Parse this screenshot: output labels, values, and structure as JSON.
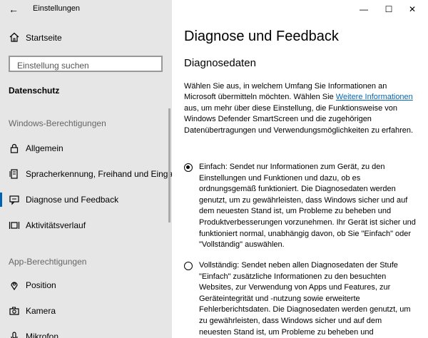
{
  "window": {
    "app_title": "Einstellungen",
    "back_icon": "←",
    "minimize_icon": "—",
    "maximize_icon": "☐",
    "close_icon": "✕"
  },
  "sidebar": {
    "home_label": "Startseite",
    "search_placeholder": "Einstellung suchen",
    "current_section": "Datenschutz",
    "group1_title": "Windows-Berechtigungen",
    "items": [
      {
        "label": "Allgemein",
        "icon": "lock-icon"
      },
      {
        "label": "Spracherkennung, Freihand und Eingabe",
        "icon": "inking-icon"
      },
      {
        "label": "Diagnose und Feedback",
        "icon": "feedback-icon",
        "active": true
      },
      {
        "label": "Aktivitätsverlauf",
        "icon": "timeline-icon"
      }
    ],
    "group2_title": "App-Berechtigungen",
    "app_items": [
      {
        "label": "Position",
        "icon": "location-icon"
      },
      {
        "label": "Kamera",
        "icon": "camera-icon"
      },
      {
        "label": "Mikrofon",
        "icon": "microphone-icon"
      }
    ]
  },
  "main": {
    "title": "Diagnose und Feedback",
    "subtitle": "Diagnosedaten",
    "intro_before": "Wählen Sie aus, in welchem Umfang Sie Informationen an Microsoft übermitteln möchten. Wählen Sie ",
    "intro_link": "Weitere Informationen",
    "intro_after": " aus, um mehr über diese Einstellung, die Funktionsweise von Windows Defender SmartScreen und die zugehörigen Datenübertragungen und Verwendungsmöglichkeiten zu erfahren.",
    "option_basic": "Einfach: Sendet nur Informationen zum Gerät, zu den Einstellungen und Funktionen und dazu, ob es ordnungsgemäß funktioniert. Die Diagnosedaten werden genutzt, um zu gewährleisten, dass Windows sicher und auf dem neuesten Stand ist, um Probleme zu beheben und Produktverbesserungen vorzunehmen. Ihr Gerät ist sicher und funktioniert normal, unabhängig davon, ob Sie \"Einfach\" oder \"Vollständig\" auswählen.",
    "option_full": "Vollständig: Sendet neben allen Diagnosedaten der Stufe \"Einfach\" zusätzliche Informationen zu den besuchten Websites, zur Verwendung von Apps und Features, zur Geräteintegrität und -nutzung sowie erweiterte Fehlerberichtsdaten. Die Diagnosedaten werden genutzt, um zu gewährleisten, dass Windows sicher und auf dem neuesten Stand ist, um Probleme zu beheben und"
  }
}
